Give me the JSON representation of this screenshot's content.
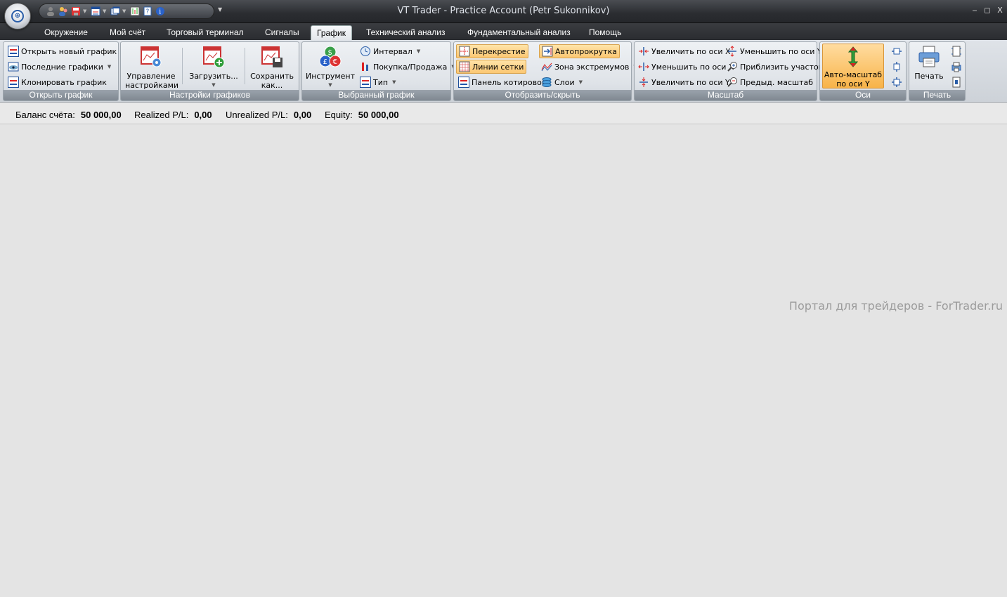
{
  "window": {
    "title": "VT Trader - Practice Account (Petr Sukonnikov)",
    "controls": {
      "minimize": "‒",
      "restore": "◻",
      "close": "X"
    }
  },
  "tabs": [
    "Окружение",
    "Мой счёт",
    "Торговый терминал",
    "Сигналы",
    "График",
    "Технический анализ",
    "Фундаментальный анализ",
    "Помощь"
  ],
  "active_tab": "График",
  "ribbon": {
    "open_chart": {
      "label": "Открыть график",
      "open_new": "Открыть новый график",
      "recent": "Последние графики",
      "clone": "Клонировать график"
    },
    "chart_settings": {
      "label": "Настройки графиков",
      "manage": [
        "Управление",
        "настройками"
      ],
      "load": "Загрузить...",
      "save_as": [
        "Сохранить",
        "как..."
      ]
    },
    "selected_chart": {
      "label": "Выбранный график",
      "instrument": "Инструмент",
      "interval": "Интервал",
      "buy_sell": "Покупка/Продажа",
      "type": "Тип"
    },
    "show_hide": {
      "label": "Отобразить/скрыть",
      "crosshair": "Перекрестие",
      "grid_lines": "Линии сетки",
      "quote_panel": "Панель котировок",
      "autoscroll": "Автопрокрутка",
      "extremum_zone": "Зона экстремумов",
      "layers": "Слои"
    },
    "scale": {
      "label": "Масштаб",
      "zoom_in_x": "Увеличить по оси X",
      "zoom_out_x": "Уменьшить по оси X",
      "zoom_in_y": "Увеличить по оси Y",
      "zoom_out_y": "Уменьшить по оси Y",
      "zoom_region": "Приблизить участок",
      "prev_scale": "Предыд. масштаб"
    },
    "axes": {
      "label": "Оси",
      "auto_scale": [
        "Авто-масштаб",
        "по оси Y"
      ]
    },
    "print": {
      "label": "Печать",
      "print": "Печать"
    }
  },
  "status": {
    "balance_label": "Баланс счёта:",
    "balance_value": "50 000,00",
    "realized_label": "Realized P/L:",
    "realized_value": "0,00",
    "unrealized_label": "Unrealized P/L:",
    "unrealized_value": "0,00",
    "equity_label": "Equity:",
    "equity_value": "50 000,00"
  },
  "watermark": "Портал для трейдеров - ForTrader.ru",
  "colors": {
    "titlebar": "#2b2d31",
    "highlight": "#fbc772",
    "workspace": "#e4e4e4"
  }
}
